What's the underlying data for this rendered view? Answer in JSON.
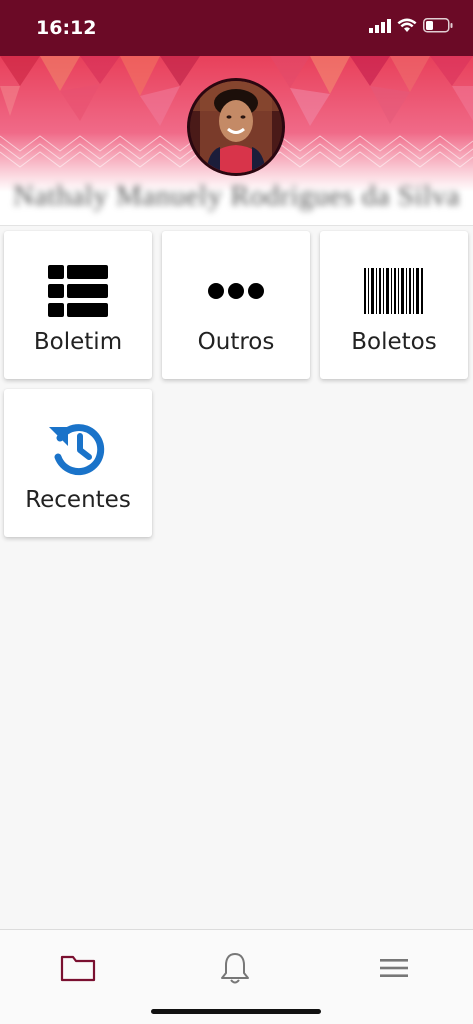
{
  "status_bar": {
    "time": "16:12",
    "icons": [
      "signal-icon",
      "wifi-icon",
      "battery-icon"
    ]
  },
  "profile": {
    "name": "Nathaly Manuely Rodrigues da Silva",
    "avatar": "avatar-photo"
  },
  "tiles": [
    {
      "label": "Boletim",
      "icon": "table-list-icon"
    },
    {
      "label": "Outros",
      "icon": "more-dots-icon"
    },
    {
      "label": "Boletos",
      "icon": "barcode-icon"
    },
    {
      "label": "Recentes",
      "icon": "history-icon"
    }
  ],
  "bottom_nav": [
    {
      "icon": "folder-icon",
      "active": true
    },
    {
      "icon": "bell-icon",
      "active": false
    },
    {
      "icon": "menu-icon",
      "active": false
    }
  ],
  "colors": {
    "status_bar": "#6b0a26",
    "accent": "#7a1030",
    "history_icon": "#1a73c9",
    "background": "#f7f7f7"
  }
}
